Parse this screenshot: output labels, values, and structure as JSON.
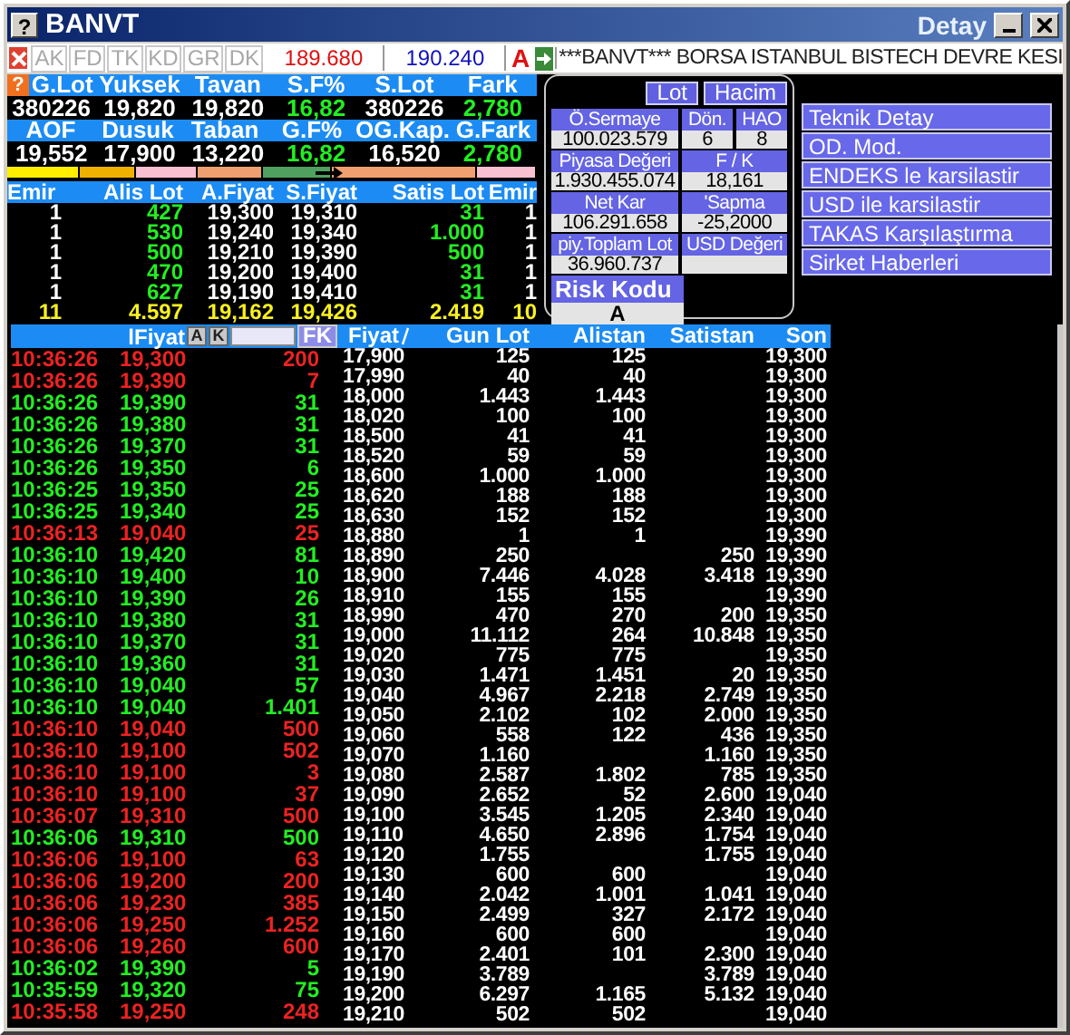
{
  "window": {
    "help": "?",
    "title": "BANVT",
    "subtitle": "Detay"
  },
  "toolbar": {
    "tabs": [
      {
        "label": "AK",
        "disabled": true
      },
      {
        "label": "FD",
        "disabled": true
      },
      {
        "label": "TK",
        "disabled": true
      },
      {
        "label": "KD",
        "disabled": true
      },
      {
        "label": "GR",
        "disabled": true
      },
      {
        "label": "DK",
        "disabled": true
      }
    ],
    "bid": "189.680",
    "ask": "190.240",
    "flag": "A",
    "ticker": "***BANVT*** BORSA ISTANBUL BISTECH DEVRE KESI"
  },
  "stats": {
    "help": "?",
    "blocks": [
      [
        {
          "label": "G.Lot",
          "value": "380226",
          "highlight": false
        },
        {
          "label": "Yuksek",
          "value": "19,820",
          "highlight": false
        },
        {
          "label": "Tavan",
          "value": "19,820",
          "highlight": false
        },
        {
          "label": "S.F%",
          "value": "16,82",
          "highlight": true
        },
        {
          "label": "S.Lot",
          "value": "380226",
          "highlight": false
        },
        {
          "label": "Fark",
          "value": "2,780",
          "highlight": true
        }
      ],
      [
        {
          "label": "AOF",
          "value": "19,552",
          "highlight": false
        },
        {
          "label": "Dusuk",
          "value": "17,900",
          "highlight": false
        },
        {
          "label": "Taban",
          "value": "13,220",
          "highlight": false
        },
        {
          "label": "G.F%",
          "value": "16,82",
          "highlight": true
        },
        {
          "label": "OG.Kap.",
          "value": "16,520",
          "highlight": false
        },
        {
          "label": "G.Fark",
          "value": "2,780",
          "highlight": true
        }
      ]
    ]
  },
  "depth": {
    "columns": [
      "Emir",
      "Alis Lot",
      "A.Fiyat",
      "S.Fiyat",
      "Satis Lot",
      "Emir"
    ],
    "rows": [
      [
        "1",
        "427",
        "19,300",
        "19,310",
        "31",
        "1"
      ],
      [
        "1",
        "530",
        "19,240",
        "19,340",
        "1.000",
        "1"
      ],
      [
        "1",
        "500",
        "19,210",
        "19,390",
        "500",
        "1"
      ],
      [
        "1",
        "470",
        "19,200",
        "19,400",
        "31",
        "1"
      ],
      [
        "1",
        "627",
        "19,190",
        "19,410",
        "31",
        "1"
      ]
    ],
    "total": [
      "11",
      "4.597",
      "19,162",
      "19,426",
      "2.419",
      "10"
    ]
  },
  "info_panel": {
    "buttons": [
      "Lot",
      "Hacim"
    ],
    "rows": [
      [
        {
          "label": "Ö.Sermaye",
          "value": "100.023.579"
        },
        {
          "label": "Dön.",
          "value": "6"
        },
        {
          "label": "HAO",
          "value": "8"
        }
      ],
      [
        {
          "label": "Piyasa Değeri",
          "value": "1.930.455.074"
        },
        {
          "label": "F / K",
          "value": "18,161"
        }
      ],
      [
        {
          "label": "Net Kar",
          "value": "106.291.658"
        },
        {
          "label": "'Sapma",
          "value": "-25,2000"
        }
      ],
      [
        {
          "label": "piy.Toplam Lot",
          "value": "36.960.737"
        },
        {
          "label": "USD Değeri"
        }
      ]
    ],
    "risk": {
      "label": "Risk Kodu",
      "value": "A"
    }
  },
  "menu": [
    "Teknik Detay",
    "OD. Mod.",
    "ENDEKS le karsilastir",
    "USD ile karsilastir",
    "TAKAS Karşılaştırma",
    "Sirket Haberleri"
  ],
  "trades": {
    "header": "lFiyat",
    "buttons": [
      "A",
      "K"
    ],
    "filter_button": "FK",
    "rows": [
      {
        "time": "10:36:26",
        "price": "19,300",
        "lot": "200",
        "color": "#ee2222"
      },
      {
        "time": "10:36:26",
        "price": "19,390",
        "lot": "7",
        "color": "#ee2222"
      },
      {
        "time": "10:36:26",
        "price": "19,390",
        "lot": "31",
        "color": "#22ee22"
      },
      {
        "time": "10:36:26",
        "price": "19,380",
        "lot": "31",
        "color": "#22ee22"
      },
      {
        "time": "10:36:26",
        "price": "19,370",
        "lot": "31",
        "color": "#22ee22"
      },
      {
        "time": "10:36:26",
        "price": "19,350",
        "lot": "6",
        "color": "#22ee22"
      },
      {
        "time": "10:36:25",
        "price": "19,350",
        "lot": "25",
        "color": "#22ee22"
      },
      {
        "time": "10:36:25",
        "price": "19,340",
        "lot": "25",
        "color": "#22ee22"
      },
      {
        "time": "10:36:13",
        "price": "19,040",
        "lot": "25",
        "color": "#ee2222"
      },
      {
        "time": "10:36:10",
        "price": "19,420",
        "lot": "81",
        "color": "#22ee22"
      },
      {
        "time": "10:36:10",
        "price": "19,400",
        "lot": "10",
        "color": "#22ee22"
      },
      {
        "time": "10:36:10",
        "price": "19,390",
        "lot": "26",
        "color": "#22ee22"
      },
      {
        "time": "10:36:10",
        "price": "19,380",
        "lot": "31",
        "color": "#22ee22"
      },
      {
        "time": "10:36:10",
        "price": "19,370",
        "lot": "31",
        "color": "#22ee22"
      },
      {
        "time": "10:36:10",
        "price": "19,360",
        "lot": "31",
        "color": "#22ee22"
      },
      {
        "time": "10:36:10",
        "price": "19,040",
        "lot": "57",
        "color": "#22ee22"
      },
      {
        "time": "10:36:10",
        "price": "19,040",
        "lot": "1.401",
        "color": "#22ee22"
      },
      {
        "time": "10:36:10",
        "price": "19,040",
        "lot": "500",
        "color": "#ee2222"
      },
      {
        "time": "10:36:10",
        "price": "19,100",
        "lot": "502",
        "color": "#ee2222"
      },
      {
        "time": "10:36:10",
        "price": "19,100",
        "lot": "3",
        "color": "#ee2222"
      },
      {
        "time": "10:36:10",
        "price": "19,100",
        "lot": "37",
        "color": "#ee2222"
      },
      {
        "time": "10:36:07",
        "price": "19,310",
        "lot": "500",
        "color": "#ee2222"
      },
      {
        "time": "10:36:06",
        "price": "19,310",
        "lot": "500",
        "color": "#22ee22"
      },
      {
        "time": "10:36:06",
        "price": "19,100",
        "lot": "63",
        "color": "#ee2222"
      },
      {
        "time": "10:36:06",
        "price": "19,200",
        "lot": "200",
        "color": "#ee2222"
      },
      {
        "time": "10:36:06",
        "price": "19,230",
        "lot": "385",
        "color": "#ee2222"
      },
      {
        "time": "10:36:06",
        "price": "19,250",
        "lot": "1.252",
        "color": "#ee2222"
      },
      {
        "time": "10:36:06",
        "price": "19,260",
        "lot": "600",
        "color": "#ee2222"
      },
      {
        "time": "10:36:02",
        "price": "19,390",
        "lot": "5",
        "color": "#22ee22"
      },
      {
        "time": "10:35:59",
        "price": "19,320",
        "lot": "75",
        "color": "#22ee22"
      },
      {
        "time": "10:35:58",
        "price": "19,250",
        "lot": "248",
        "color": "#ee2222"
      }
    ]
  },
  "prices": {
    "columns": [
      "Fiyat",
      "Gun Lot",
      "Alistan",
      "Satistan",
      "Son"
    ],
    "rows": [
      [
        "17,900",
        "125",
        "125",
        null,
        "19,300"
      ],
      [
        "17,990",
        "40",
        "40",
        null,
        "19,300"
      ],
      [
        "18,000",
        "1.443",
        "1.443",
        null,
        "19,300"
      ],
      [
        "18,020",
        "100",
        "100",
        null,
        "19,300"
      ],
      [
        "18,500",
        "41",
        "41",
        null,
        "19,300"
      ],
      [
        "18,520",
        "59",
        "59",
        null,
        "19,300"
      ],
      [
        "18,600",
        "1.000",
        "1.000",
        null,
        "19,300"
      ],
      [
        "18,620",
        "188",
        "188",
        null,
        "19,300"
      ],
      [
        "18,630",
        "152",
        "152",
        null,
        "19,300"
      ],
      [
        "18,880",
        "1",
        "1",
        null,
        "19,390"
      ],
      [
        "18,890",
        "250",
        null,
        "250",
        "19,390"
      ],
      [
        "18,900",
        "7.446",
        "4.028",
        "3.418",
        "19,390"
      ],
      [
        "18,910",
        "155",
        "155",
        null,
        "19,390"
      ],
      [
        "18,990",
        "470",
        "270",
        "200",
        "19,350"
      ],
      [
        "19,000",
        "11.112",
        "264",
        "10.848",
        "19,350"
      ],
      [
        "19,020",
        "775",
        "775",
        null,
        "19,350"
      ],
      [
        "19,030",
        "1.471",
        "1.451",
        "20",
        "19,350"
      ],
      [
        "19,040",
        "4.967",
        "2.218",
        "2.749",
        "19,350"
      ],
      [
        "19,050",
        "2.102",
        "102",
        "2.000",
        "19,350"
      ],
      [
        "19,060",
        "558",
        "122",
        "436",
        "19,350"
      ],
      [
        "19,070",
        "1.160",
        null,
        "1.160",
        "19,350"
      ],
      [
        "19,080",
        "2.587",
        "1.802",
        "785",
        "19,350"
      ],
      [
        "19,090",
        "2.652",
        "52",
        "2.600",
        "19,040"
      ],
      [
        "19,100",
        "3.545",
        "1.205",
        "2.340",
        "19,040"
      ],
      [
        "19,110",
        "4.650",
        "2.896",
        "1.754",
        "19,040"
      ],
      [
        "19,120",
        "1.755",
        null,
        "1.755",
        "19,040"
      ],
      [
        "19,130",
        "600",
        "600",
        null,
        "19,040"
      ],
      [
        "19,140",
        "2.042",
        "1.001",
        "1.041",
        "19,040"
      ],
      [
        "19,150",
        "2.499",
        "327",
        "2.172",
        "19,040"
      ],
      [
        "19,160",
        "600",
        "600",
        null,
        "19,040"
      ],
      [
        "19,170",
        "2.401",
        "101",
        "2.300",
        "19,040"
      ],
      [
        "19,190",
        "3.789",
        null,
        "3.789",
        "19,040"
      ],
      [
        "19,200",
        "6.297",
        "1.165",
        "5.132",
        "19,040"
      ],
      [
        "19,210",
        "502",
        "502",
        null,
        "19,040"
      ]
    ]
  }
}
